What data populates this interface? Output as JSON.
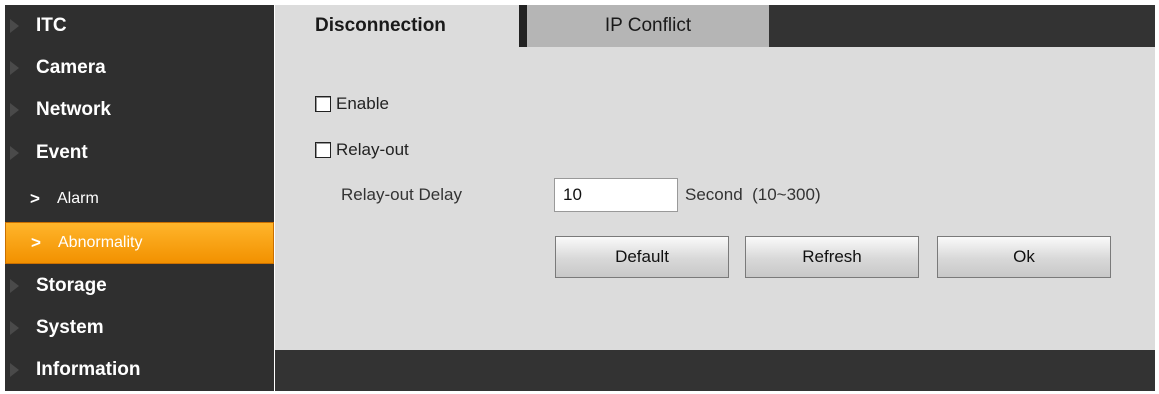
{
  "sidebar": {
    "items": [
      {
        "label": "ITC"
      },
      {
        "label": "Camera"
      },
      {
        "label": "Network"
      },
      {
        "label": "Event"
      },
      {
        "label": "Alarm"
      },
      {
        "label": "Abnormality"
      },
      {
        "label": "Storage"
      },
      {
        "label": "System"
      },
      {
        "label": "Information"
      }
    ],
    "sub_marker": ">",
    "active_item": "Abnormality",
    "active_color": "#f7a21b"
  },
  "tabs": [
    {
      "label": "Disconnection",
      "selected": true
    },
    {
      "label": "IP Conflict",
      "selected": false
    }
  ],
  "form": {
    "enable": {
      "label": "Enable",
      "checked": false
    },
    "relay_out": {
      "label": "Relay-out",
      "checked": false
    },
    "relay_delay": {
      "label": "Relay-out Delay",
      "value": "10",
      "unit": "Second  (10~300)"
    }
  },
  "buttons": {
    "default": "Default",
    "refresh": "Refresh",
    "ok": "Ok"
  }
}
